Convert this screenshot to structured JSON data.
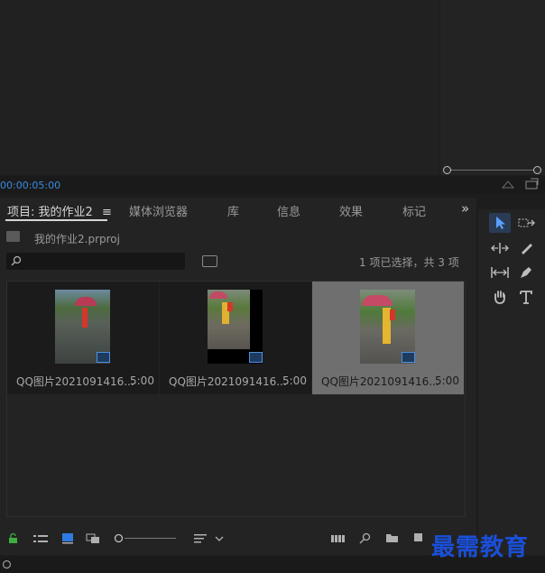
{
  "monitor": {
    "timecode": "00:00:05:00"
  },
  "tabs": [
    {
      "label": "项目: 我的作业2",
      "menu": "≡"
    },
    {
      "label": "媒体浏览器"
    },
    {
      "label": "库"
    },
    {
      "label": "信息"
    },
    {
      "label": "效果"
    },
    {
      "label": "标记"
    }
  ],
  "overflow": "»",
  "project": {
    "file": "我的作业2.prproj",
    "search_placeholder": "",
    "selection_status": "1 项已选择，共 3 项"
  },
  "clips": [
    {
      "name": "QQ图片2021091416...",
      "duration": "5:00",
      "selected": false
    },
    {
      "name": "QQ图片2021091416...",
      "duration": "5:00",
      "selected": false
    },
    {
      "name": "QQ图片2021091416...",
      "duration": "5:00",
      "selected": true
    }
  ],
  "tools": [
    "selection-icon",
    "track-select-icon",
    "ripple-edit-icon",
    "razor-icon",
    "slip-icon",
    "pen-icon",
    "hand-icon",
    "type-icon"
  ],
  "watermark": "最需教育",
  "colors": {
    "accent": "#3b8be0",
    "selection": "#6f6f6f"
  }
}
